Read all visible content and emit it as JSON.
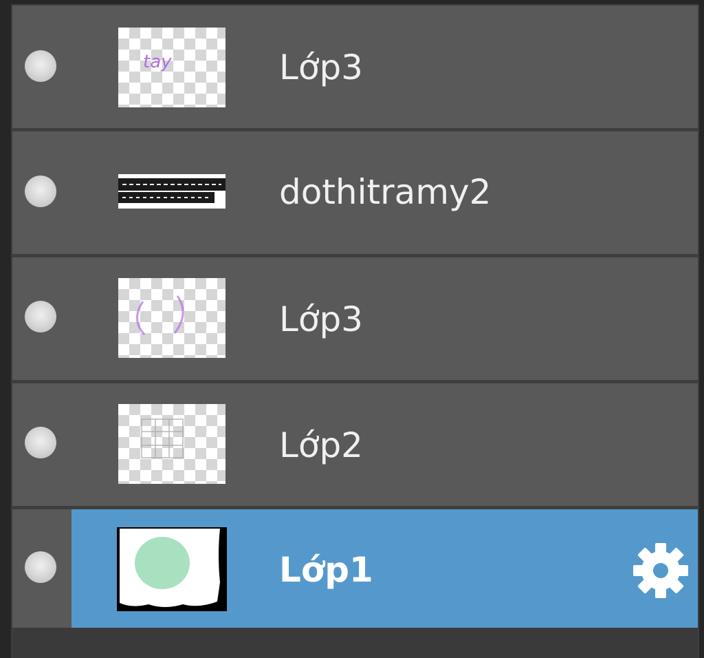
{
  "layers": [
    {
      "name": "Lớp3",
      "thumbnail": "transparent-with-purple-text",
      "selected": false
    },
    {
      "name": "dothitramy2",
      "thumbnail": "text-strip",
      "selected": false
    },
    {
      "name": "Lớp3",
      "thumbnail": "transparent-with-purple-circle",
      "selected": false
    },
    {
      "name": "Lớp2",
      "thumbnail": "transparent-with-grid-sketch",
      "selected": false
    },
    {
      "name": "Lớp1",
      "thumbnail": "white-with-green-blob",
      "selected": true
    }
  ],
  "icons": {
    "visibility": "visibility-dot-icon",
    "settings": "gear-icon"
  },
  "colors": {
    "panel_bg": "#3e3e3e",
    "row_bg": "#595959",
    "selected_bg": "#5599cc",
    "text": "#f0f0f0",
    "thumb_accent_purple": "#b070e0",
    "thumb_accent_green": "#a8e0c0"
  }
}
